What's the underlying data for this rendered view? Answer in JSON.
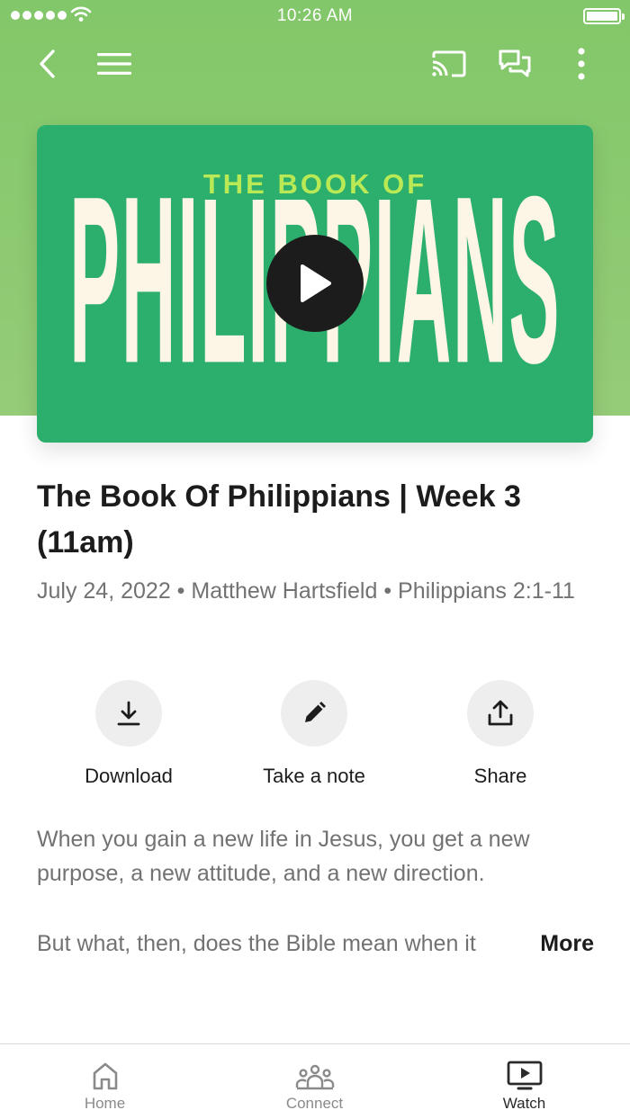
{
  "status_bar": {
    "time": "10:26 AM"
  },
  "nav": {
    "back_icon": "chevron-left-icon",
    "menu_icon": "hamburger-menu-icon",
    "cast_icon": "cast-icon",
    "chat_icon": "chat-bubbles-icon",
    "more_icon": "more-vertical-icon"
  },
  "artwork": {
    "small_text": "THE BOOK OF",
    "big_text": "PHILIPPIANS",
    "background_color": "#2cae6d",
    "accent_color": "#b9ea56"
  },
  "sermon": {
    "title": "The Book Of Philippians | Week 3 (11am)",
    "meta": "July 24, 2022 • Matthew Hartsfield • Philippians 2:1-11"
  },
  "actions": [
    {
      "label": "Download",
      "icon": "download-icon"
    },
    {
      "label": "Take a note",
      "icon": "pencil-icon"
    },
    {
      "label": "Share",
      "icon": "share-icon"
    }
  ],
  "description": {
    "paragraph1": "When you gain a new life in Jesus, you get a new purpose, a new attitude, and a new direction.",
    "paragraph2": "But what, then, does the Bible mean when it",
    "more_label": "More"
  },
  "tabs": [
    {
      "label": "Home",
      "icon": "home-icon",
      "active": false
    },
    {
      "label": "Connect",
      "icon": "people-icon",
      "active": false
    },
    {
      "label": "Watch",
      "icon": "tv-play-icon",
      "active": true
    }
  ],
  "colors": {
    "header_green": "#8ec873",
    "text_gray": "#727272"
  }
}
